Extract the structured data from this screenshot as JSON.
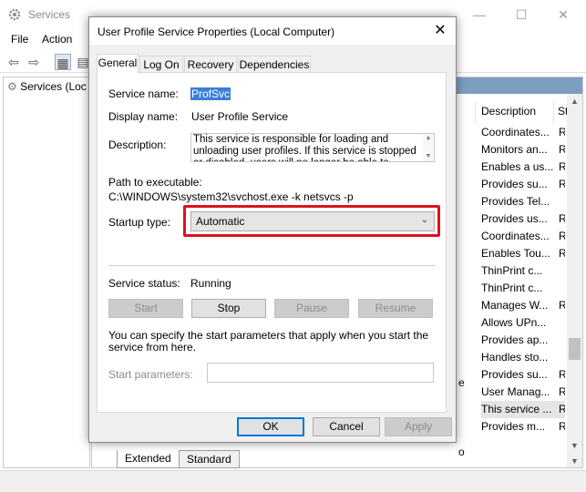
{
  "bg": {
    "title": "Services",
    "menu": [
      "File",
      "Action"
    ],
    "tree_item": "Services (Loc",
    "columns": {
      "description": "Description",
      "status": "St"
    },
    "rows": [
      {
        "desc": "Coordinates...",
        "st": "Ru"
      },
      {
        "desc": "Monitors an...",
        "st": "Ru"
      },
      {
        "desc": "Enables a us...",
        "st": "Ru"
      },
      {
        "desc": "Provides su...",
        "st": "Ru"
      },
      {
        "desc": "Provides Tel...",
        "st": ""
      },
      {
        "desc": "Provides us...",
        "st": "Ru"
      },
      {
        "desc": "Coordinates...",
        "st": "Ru"
      },
      {
        "desc": "Enables Tou...",
        "st": "Ru"
      },
      {
        "desc": "ThinPrint c...",
        "st": ""
      },
      {
        "desc": "ThinPrint c...",
        "st": ""
      },
      {
        "desc": "Manages W...",
        "st": "Ru"
      },
      {
        "desc": "Allows UPn...",
        "st": ""
      },
      {
        "desc": "Provides ap...",
        "st": ""
      },
      {
        "desc": "Handles sto...",
        "st": ""
      },
      {
        "desc": "Provides su...",
        "st": "Ru"
      },
      {
        "desc": "User Manag...",
        "st": "Ru"
      },
      {
        "desc": "This service ...",
        "st": "Ru"
      },
      {
        "desc": "Provides m...",
        "st": "Ru"
      }
    ],
    "selected_row": 16,
    "partial_e": "e",
    "partial_o": "o",
    "tabs": [
      "Extended",
      "Standard"
    ]
  },
  "dialog": {
    "title": "User Profile Service Properties (Local Computer)",
    "close": "✕",
    "tabs": [
      "General",
      "Log On",
      "Recovery",
      "Dependencies"
    ],
    "service_name_label": "Service name:",
    "service_name": "ProfSvc",
    "display_name_label": "Display name:",
    "display_name": "User Profile Service",
    "description_label": "Description:",
    "description": "This service is responsible for loading and unloading user profiles. If this service is stopped or disabled, users will no longer be able to successfully sign in or",
    "path_label": "Path to executable:",
    "path": "C:\\WINDOWS\\system32\\svchost.exe -k netsvcs -p",
    "startup_label": "Startup type:",
    "startup_value": "Automatic",
    "status_label": "Service status:",
    "status_value": "Running",
    "buttons": {
      "start": "Start",
      "stop": "Stop",
      "pause": "Pause",
      "resume": "Resume"
    },
    "info": "You can specify the start parameters that apply when you start the service from here.",
    "params_label": "Start parameters:",
    "ok": "OK",
    "cancel": "Cancel",
    "apply": "Apply"
  },
  "colors": {
    "highlight": "#e0101c",
    "selection": "#3b7fd9",
    "banner": "#7d9ec0"
  }
}
